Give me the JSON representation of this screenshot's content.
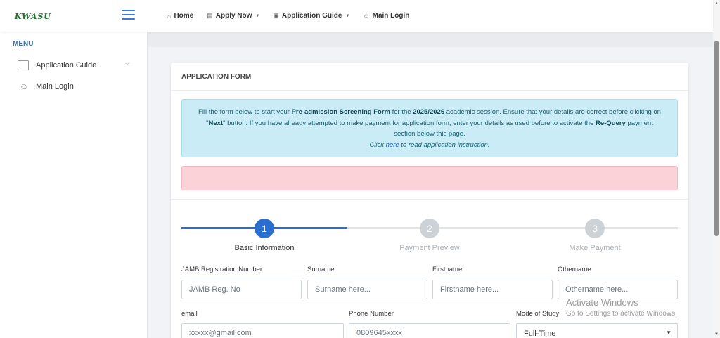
{
  "header": {
    "logo_text": "KWASU",
    "nav": [
      {
        "label": "Home",
        "icon": "home-icon"
      },
      {
        "label": "Apply Now",
        "icon": "file-icon"
      },
      {
        "label": "Application Guide",
        "icon": "guide-icon"
      },
      {
        "label": "Main Login",
        "icon": "users-icon"
      }
    ]
  },
  "sidebar": {
    "title": "MENU",
    "items": [
      {
        "label": "Application Guide",
        "icon": "book-icon"
      },
      {
        "label": "Main Login",
        "icon": "users-icon"
      }
    ]
  },
  "card": {
    "title": "APPLICATION FORM",
    "alert": {
      "t1": "Fill the form below to start your ",
      "b1": "Pre-admission Screening Form",
      "t2": " for the ",
      "b2": "2025/2026",
      "t3": " academic session. Ensure that your details are correct before clicking on \"",
      "b3": "Next",
      "t4": "\" button. If you have already attempted to make payment for application form, enter your details as used before to activate the ",
      "b4": "Re-Query",
      "t5": " payment section below this page.",
      "click": "Click ",
      "here": "here",
      "tail": " to read application instruction."
    }
  },
  "steps": [
    {
      "number": "1",
      "label": "Basic Information",
      "active": true
    },
    {
      "number": "2",
      "label": "Payment Preview",
      "active": false
    },
    {
      "number": "3",
      "label": "Make Payment",
      "active": false
    }
  ],
  "form": {
    "jamb": {
      "label": "JAMB Registration Number",
      "placeholder": "JAMB Reg. No"
    },
    "surname": {
      "label": "Surname",
      "placeholder": "Surname here..."
    },
    "firstname": {
      "label": "Firstname",
      "placeholder": "Firstname here..."
    },
    "othername": {
      "label": "Othername",
      "placeholder": "Othername here..."
    },
    "email": {
      "label": "email",
      "placeholder": "xxxxx@gmail.com"
    },
    "phone": {
      "label": "Phone Number",
      "placeholder": "0809645xxxx"
    },
    "mode": {
      "label": "Mode of Study",
      "value": "Full-Time"
    }
  },
  "watermark": {
    "line1": "Activate Windows",
    "line2": "Go to Settings to activate Windows."
  },
  "colors": {
    "primary": "#2a6fcf",
    "inactive": "#cdd2d6",
    "info_bg": "#c9ecf7",
    "danger_bg": "#fcd2d9"
  }
}
